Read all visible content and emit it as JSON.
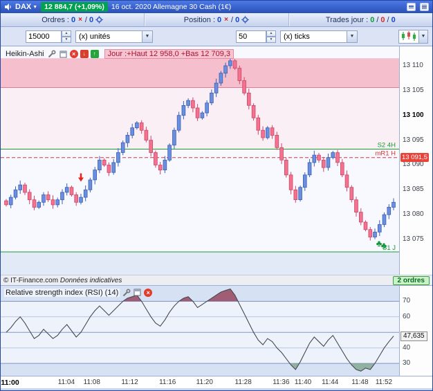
{
  "sep": "/",
  "title_bar": {
    "instrument": "DAX",
    "price_badge": "12 884,7 (+1,09%)",
    "session_info": "16 oct. 2020 Allemagne 30 Cash (1€)"
  },
  "orders_bar": {
    "orders_label": "Ordres :",
    "orders_working": "0",
    "orders_pending": "0",
    "position_label": "Position :",
    "position_open": "0",
    "position_pending": "0",
    "trades_label": "Trades jour :",
    "trades_values": [
      "0",
      "0",
      "0"
    ]
  },
  "controls_bar": {
    "qty_value": "15000",
    "qty_unit": "(x) unités",
    "tick_value": "50",
    "tick_unit": "(x) ticks"
  },
  "main_chart": {
    "indicator_label": "Heikin-Ashi",
    "day_levels_label": "Jour :+Haut 12 958,0 +Bas 12 709,3",
    "footer_copyright": "© IT-Finance.com",
    "footer_note": "Données indicatives",
    "orders_badge": "2 ordres",
    "price_ticks": [
      {
        "label": "13 110",
        "value": 13110
      },
      {
        "label": "13 105",
        "value": 13105
      },
      {
        "label": "13 100",
        "value": 13100,
        "bold": true
      },
      {
        "label": "13 095",
        "value": 13095
      },
      {
        "label": "13 090",
        "value": 13090
      },
      {
        "label": "13 085",
        "value": 13085
      },
      {
        "label": "13 080",
        "value": 13080
      },
      {
        "label": "13 075",
        "value": 13075
      }
    ],
    "level_badge": {
      "label": "13 091,5",
      "value": 13091.5
    }
  },
  "rsi_panel": {
    "label": "Relative strength index (RSI) (14)",
    "value_badge": "47,635",
    "ticks": [
      {
        "label": "70",
        "value": 70
      },
      {
        "label": "60",
        "value": 60
      },
      {
        "label": "40",
        "value": 40
      },
      {
        "label": "30",
        "value": 30
      }
    ]
  },
  "time_axis": {
    "ticks": [
      {
        "label": "11:00",
        "frac": 0.025,
        "bold": true
      },
      {
        "label": "11:04",
        "frac": 0.168
      },
      {
        "label": "11:08",
        "frac": 0.232
      },
      {
        "label": "11:12",
        "frac": 0.327
      },
      {
        "label": "11:16",
        "frac": 0.422
      },
      {
        "label": "11:20",
        "frac": 0.515
      },
      {
        "label": "11:28",
        "frac": 0.612
      },
      {
        "label": "11:36",
        "frac": 0.707
      },
      {
        "label": "11:40",
        "frac": 0.762
      },
      {
        "label": "11:44",
        "frac": 0.83
      },
      {
        "label": "11:48",
        "frac": 0.905
      },
      {
        "label": "11:52",
        "frac": 0.965
      }
    ]
  },
  "chart_data": [
    {
      "type": "candlestick",
      "name": "Heikin-Ashi",
      "ylim": [
        13067.9,
        13113.9
      ],
      "closes": [
        13082.0,
        13083.5,
        13085.0,
        13086.0,
        13084.5,
        13083.0,
        13081.5,
        13082.5,
        13084.0,
        13083.0,
        13082.0,
        13083.0,
        13084.5,
        13085.5,
        13084.0,
        13082.5,
        13083.5,
        13085.0,
        13087.0,
        13089.0,
        13091.0,
        13090.0,
        13088.5,
        13090.5,
        13092.5,
        13094.5,
        13096.0,
        13097.5,
        13098.5,
        13097.0,
        13095.0,
        13092.5,
        13090.0,
        13089.0,
        13091.0,
        13094.0,
        13097.0,
        13100.0,
        13102.0,
        13103.0,
        13101.5,
        13099.5,
        13100.5,
        13102.5,
        13104.5,
        13106.5,
        13108.5,
        13110.0,
        13111.0,
        13109.5,
        13107.0,
        13104.5,
        13102.0,
        13099.5,
        13097.0,
        13095.5,
        13097.5,
        13096.0,
        13093.5,
        13091.0,
        13088.0,
        13085.0,
        13083.0,
        13085.5,
        13088.0,
        13090.5,
        13092.0,
        13091.0,
        13089.5,
        13091.5,
        13092.5,
        13090.5,
        13088.0,
        13085.5,
        13083.0,
        13080.5,
        13078.5,
        13077.0,
        13075.5,
        13076.5,
        13078.0,
        13080.0,
        13081.5,
        13082.5
      ],
      "zones": {
        "band_top": 13111.5,
        "band_bottom": 13105.6,
        "band_color": "#f5bfcd",
        "band_edge": "#e27a93",
        "mid_zone_color": "#f9eff5",
        "below_color": "#e2eaf8"
      },
      "levels": [
        {
          "price": 13093.2,
          "label": "S2 4H",
          "color": "#199a33",
          "style": "solid"
        },
        {
          "price": 13091.5,
          "label": "mR1 H",
          "color": "#e03030",
          "style": "dashed"
        },
        {
          "price": 13072.5,
          "label": "S1 J",
          "color": "#199a33",
          "style": "solid"
        }
      ],
      "markers": {
        "sell_arrow": {
          "index": 16,
          "price": 13087.2,
          "color": "#e02818"
        },
        "order_clover": {
          "index": 80,
          "price": 13074.2,
          "glyph": "♣",
          "color": "#14953c"
        }
      },
      "colors": {
        "up_fill": "#6b8fdc",
        "up_stroke": "#3a5fb8",
        "down_fill": "#f2738f",
        "down_stroke": "#cf4566"
      }
    },
    {
      "type": "line",
      "name": "Relative strength index (RSI) (14)",
      "ylim": [
        22,
        80
      ],
      "values": [
        50,
        53,
        57,
        60,
        56,
        51,
        46,
        48,
        52,
        49,
        46,
        48,
        52,
        55,
        51,
        47,
        50,
        55,
        60,
        64,
        67,
        64,
        61,
        64,
        67,
        70,
        72,
        73,
        74,
        70,
        65,
        60,
        56,
        54,
        58,
        63,
        67,
        70,
        72,
        73,
        70,
        66,
        68,
        70,
        72,
        74,
        76,
        77,
        78,
        74,
        68,
        62,
        56,
        50,
        45,
        42,
        46,
        44,
        40,
        37,
        33,
        29,
        26,
        31,
        37,
        43,
        47,
        44,
        41,
        45,
        48,
        43,
        38,
        33,
        29,
        26,
        25,
        27,
        26,
        30,
        35,
        40,
        44,
        47.6
      ],
      "hlines": [
        {
          "value": 70,
          "major": true
        },
        {
          "value": 60,
          "major": false
        },
        {
          "value": 50,
          "major": true
        },
        {
          "value": 40,
          "major": false
        },
        {
          "value": 30,
          "major": true
        }
      ],
      "overbought": 70,
      "oversold": 30,
      "last_value": 47.635,
      "colors": {
        "line": "#45484f",
        "over_fill": "#8d3048",
        "under_fill": "#7aa184",
        "band_bg": "#d6e1f3",
        "mid_bg": "#eef3fb"
      }
    }
  ]
}
